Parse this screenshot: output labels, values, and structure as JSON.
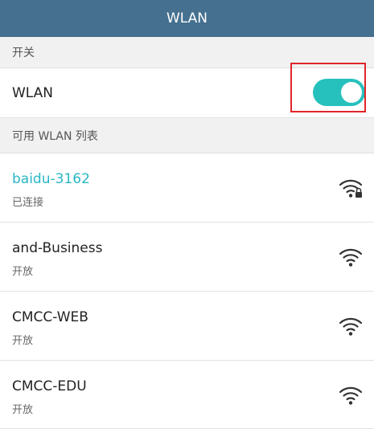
{
  "title": "WLAN",
  "switch_section": {
    "header": "开关",
    "wlan_label": "WLAN",
    "wlan_enabled": true
  },
  "list_section_header": "可用 WLAN 列表",
  "networks": [
    {
      "name": "baidu-3162",
      "status": "已连接",
      "connected": true,
      "locked": true,
      "icon": "wifi-lock-icon"
    },
    {
      "name": "and-Business",
      "status": "开放",
      "connected": false,
      "locked": false,
      "icon": "wifi-icon"
    },
    {
      "name": "CMCC-WEB",
      "status": "开放",
      "connected": false,
      "locked": false,
      "icon": "wifi-icon"
    },
    {
      "name": "CMCC-EDU",
      "status": "开放",
      "connected": false,
      "locked": false,
      "icon": "wifi-icon"
    }
  ],
  "colors": {
    "titlebar": "#45708f",
    "accent": "#27c1bd",
    "connected_text": "#28b7c4",
    "highlight": "#e0262a"
  }
}
